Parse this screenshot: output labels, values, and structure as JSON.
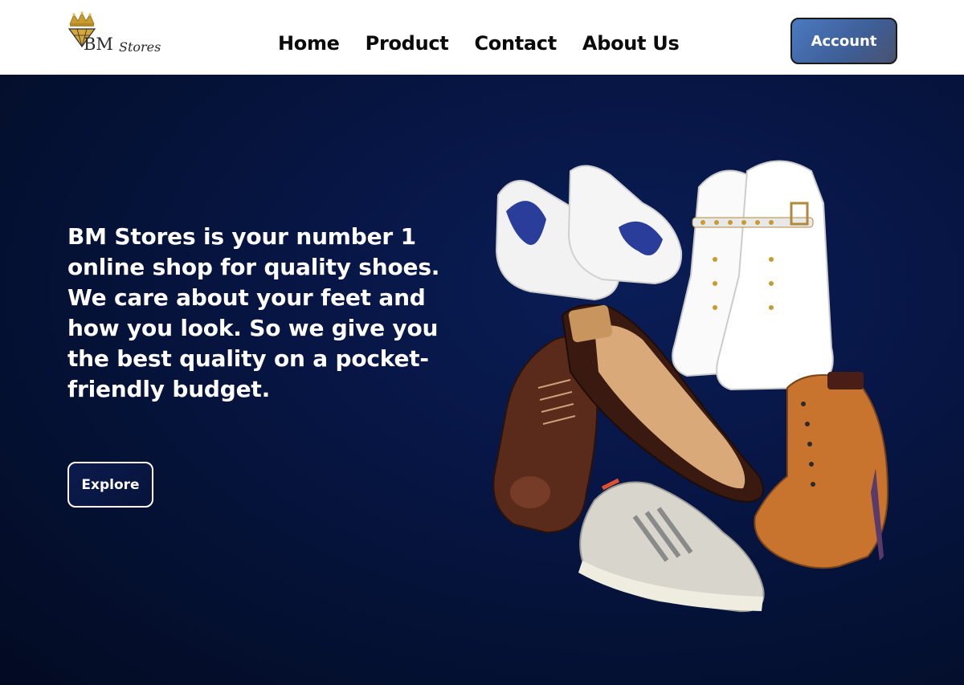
{
  "brand": {
    "logo_text": "BMStores",
    "logo_colors": {
      "gold": "#c99a2e",
      "dark": "#2a2a2a"
    }
  },
  "nav": {
    "items": [
      {
        "label": "Home"
      },
      {
        "label": "Product"
      },
      {
        "label": "Contact"
      },
      {
        "label": "About Us"
      }
    ],
    "account_label": "Account"
  },
  "hero": {
    "paragraph_1": "BM Stores is your number 1 online shop for quality shoes.",
    "paragraph_2": "We care about your feet and how you look. So we give you the best quality on a pocket-friendly budget.",
    "cta_label": "Explore",
    "image_subject": "shoe-collage"
  },
  "colors": {
    "header_bg": "#ffffff",
    "hero_bg": "#061440",
    "account_button": "#4b7ac2",
    "text_light": "#ffffff"
  }
}
